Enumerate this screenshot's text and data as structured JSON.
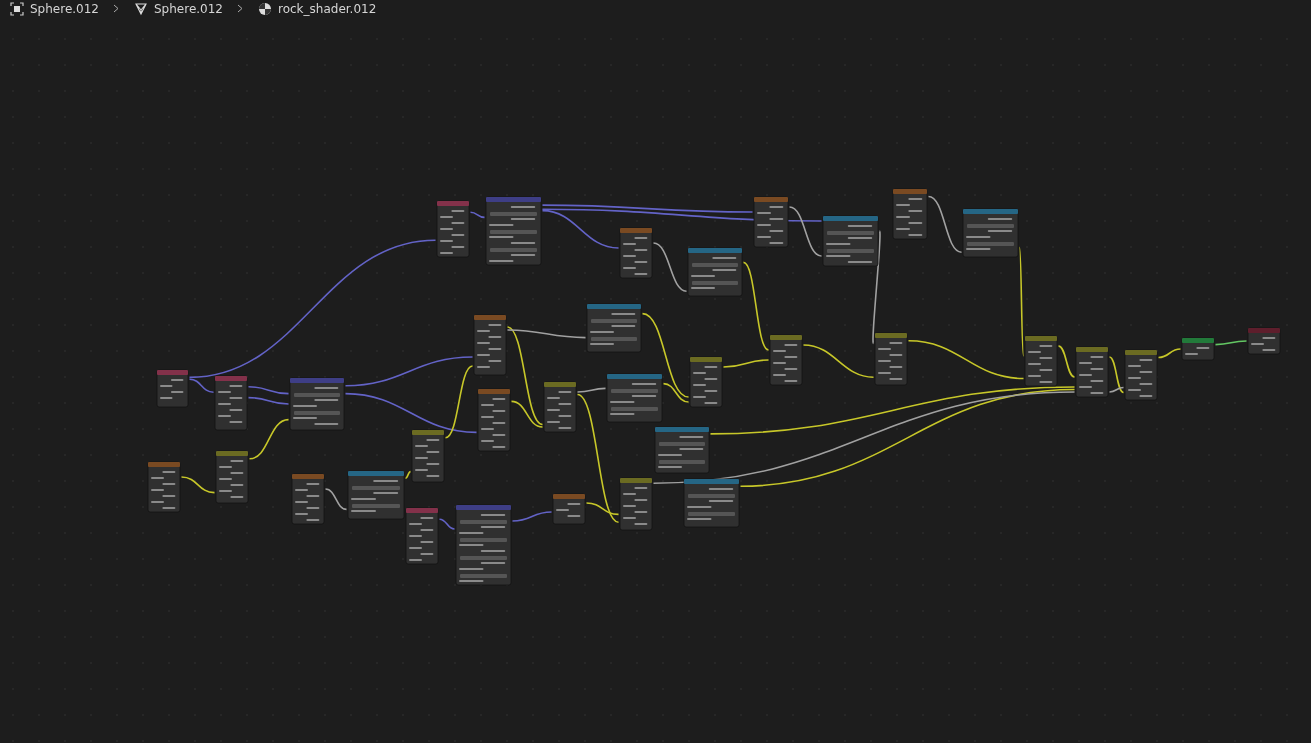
{
  "breadcrumbs": [
    {
      "kind": "object",
      "label": "Sphere.012"
    },
    {
      "kind": "mesh",
      "label": "Sphere.012"
    },
    {
      "kind": "material",
      "label": "rock_shader.012"
    }
  ],
  "nodes": [
    {
      "kind": "input"
    },
    {
      "kind": "input"
    },
    {
      "kind": "vector"
    },
    {
      "kind": "input"
    },
    {
      "kind": "vector"
    },
    {
      "kind": "texture"
    },
    {
      "kind": "color"
    },
    {
      "kind": "texture"
    },
    {
      "kind": "converter"
    },
    {
      "kind": "input"
    },
    {
      "kind": "vector"
    },
    {
      "kind": "color"
    },
    {
      "kind": "texture"
    },
    {
      "kind": "texture"
    },
    {
      "kind": "color"
    },
    {
      "kind": "converter"
    },
    {
      "kind": "converter"
    },
    {
      "kind": "texture"
    },
    {
      "kind": "color"
    },
    {
      "kind": "texture"
    },
    {
      "kind": "converter"
    },
    {
      "kind": "color"
    },
    {
      "kind": "converter"
    },
    {
      "kind": "converter"
    },
    {
      "kind": "texture"
    },
    {
      "kind": "color"
    },
    {
      "kind": "converter"
    },
    {
      "kind": "color"
    },
    {
      "kind": "texture"
    },
    {
      "kind": "converter"
    },
    {
      "kind": "color"
    },
    {
      "kind": "color"
    },
    {
      "kind": "color"
    },
    {
      "kind": "shader"
    },
    {
      "kind": "output"
    }
  ]
}
